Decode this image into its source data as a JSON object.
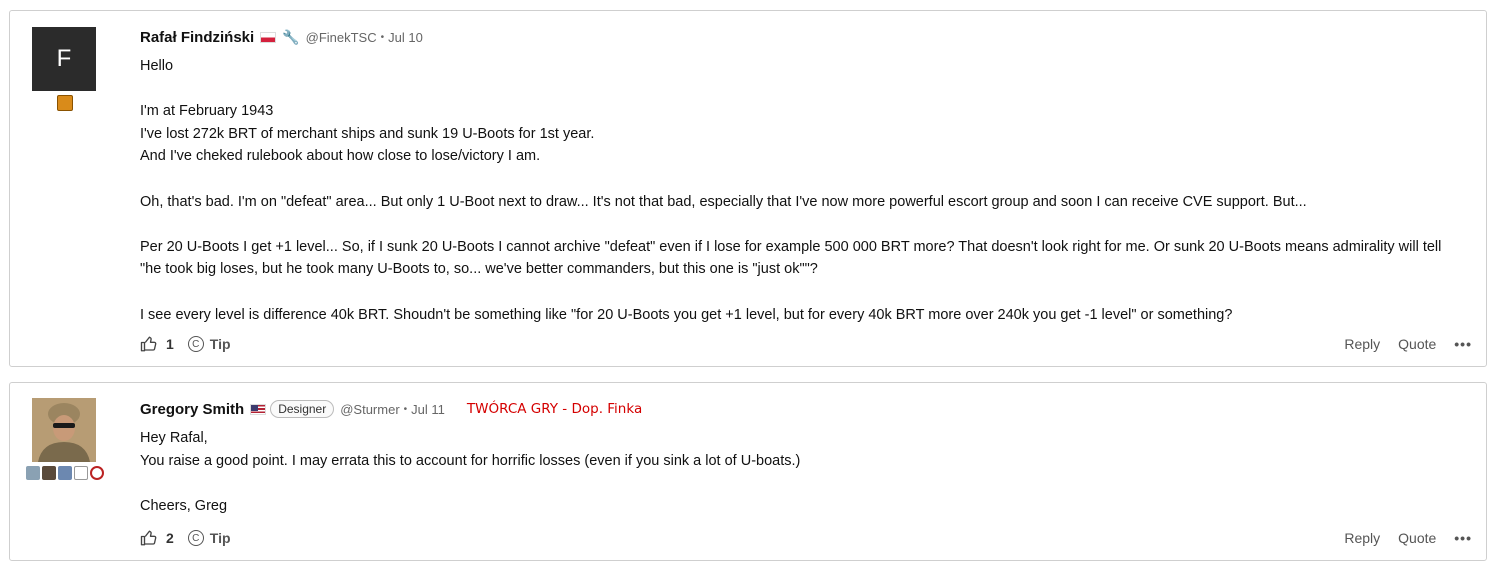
{
  "posts": [
    {
      "author": "Rafał Findziński",
      "avatar_letter": "F",
      "handle": "@FinekTSC",
      "separator": "•",
      "date": "Jul 10",
      "paragraphs": [
        [
          "Hello"
        ],
        [
          "I'm at February 1943",
          "I've lost 272k BRT of merchant ships and sunk 19 U-Boots for 1st year.",
          "And I've cheked rulebook about how close to lose/victory I am."
        ],
        [
          "Oh, that's bad. I'm on \"defeat\" area... But only 1 U-Boot next to draw... It's not that bad, especially that I've now more powerful escort group and soon I can receive CVE support. But..."
        ],
        [
          "Per 20 U-Boots I get +1 level... So, if I sunk 20 U-Boots I cannot archive \"defeat\" even if I lose for example 500 000 BRT more? That doesn't look right for me. Or sunk 20 U-Boots means admirality will tell",
          "\"he took big loses, but he took many U-Boots to, so... we've better commanders, but this one is \"just ok\"\"?"
        ],
        [
          "I see every level is difference 40k BRT. Shoudn't be something like \"for 20 U-Boots you get +1 level, but for every 40k BRT more over 240k you get -1 level\" or something?"
        ]
      ],
      "likes": "1",
      "tip_label": "Tip",
      "reply_label": "Reply",
      "quote_label": "Quote",
      "more_label": "•••"
    },
    {
      "author": "Gregory Smith",
      "badge": "Designer",
      "handle": "@Sturmer",
      "separator": "•",
      "date": "Jul 11",
      "annotation": "TWÓRCA GRY - Dop. Finka",
      "paragraphs": [
        [
          "Hey Rafal,",
          "You raise a good point. I may errata this to account for horrific losses (even if you sink a lot of U-boats.)"
        ],
        [
          "Cheers, Greg"
        ]
      ],
      "likes": "2",
      "tip_label": "Tip",
      "reply_label": "Reply",
      "quote_label": "Quote",
      "more_label": "•••"
    }
  ],
  "colors": {
    "annotation": "#d40000",
    "border": "#cfcfcf",
    "avatar_bg": "#2b2b2b"
  }
}
